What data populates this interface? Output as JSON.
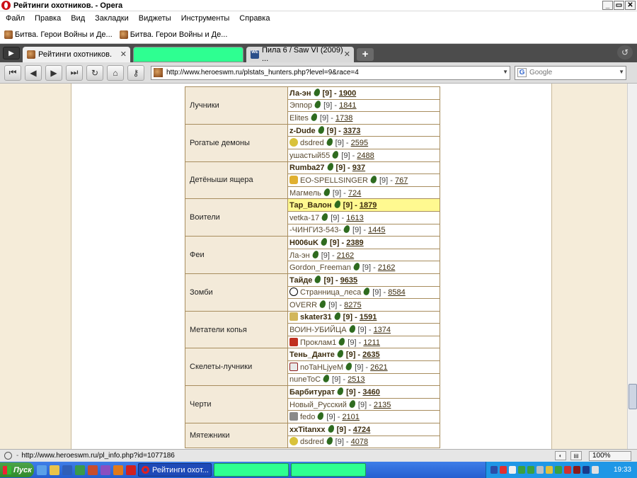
{
  "window": {
    "title": "Рейтинги охотников. - Opera",
    "controls": [
      "_",
      "▭",
      "✕"
    ]
  },
  "menu": [
    "Файл",
    "Правка",
    "Вид",
    "Закладки",
    "Виджеты",
    "Инструменты",
    "Справка"
  ],
  "bookmarks": [
    "Битва. Герои Войны и Де...",
    "Битва. Герои Войны и Де..."
  ],
  "tabs": [
    {
      "label": "Рейтинги охотников.",
      "state": "active",
      "close": "✕"
    },
    {
      "label": "",
      "state": "redacted",
      "color": "#2eff91"
    },
    {
      "label": "Пила 6 / Saw VI (2009) ...",
      "state": "inactive",
      "icon": "WE",
      "close": "✕"
    }
  ],
  "new_tab_label": "+",
  "nav": {
    "address": "http://www.heroeswm.ru/plstats_hunters.php?level=9&race=4",
    "search_placeholder": "Google",
    "search_icon_letter": "G"
  },
  "ratings": [
    {
      "class": "Лучники",
      "players": [
        {
          "nick": "Ла-эн",
          "level": "[9]",
          "score": "1900",
          "top": true
        },
        {
          "nick": "Эппор",
          "level": "[9]",
          "score": "1841"
        },
        {
          "nick": "Elites",
          "level": "[9]",
          "score": "1738"
        }
      ]
    },
    {
      "class": "Рогатые демоны",
      "players": [
        {
          "nick": "z-Dude",
          "level": "[9]",
          "score": "3373",
          "top": true
        },
        {
          "nick": "dsdred",
          "level": "[9]",
          "score": "2595",
          "badge": "lemon"
        },
        {
          "nick": "ушастый55",
          "level": "[9]",
          "score": "2488"
        }
      ]
    },
    {
      "class": "Детёныши ящера",
      "players": [
        {
          "nick": "Rumba27",
          "level": "[9]",
          "score": "937",
          "top": true
        },
        {
          "nick": "EO-SPELLSINGER",
          "level": "[9]",
          "score": "767",
          "badge": "crown"
        },
        {
          "nick": "Магмель",
          "level": "[9]",
          "score": "724"
        }
      ]
    },
    {
      "class": "Воители",
      "players": [
        {
          "nick": "Тар_Валон",
          "level": "[9]",
          "score": "1879",
          "top": true,
          "highlight": true
        },
        {
          "nick": "vetka-17",
          "level": "[9]",
          "score": "1613"
        },
        {
          "nick": "-ЧИНГИЗ-543-",
          "level": "[9]",
          "score": "1445"
        }
      ]
    },
    {
      "class": "Феи",
      "players": [
        {
          "nick": "H006uK",
          "level": "[9]",
          "score": "2389",
          "top": true
        },
        {
          "nick": "Ла-эн",
          "level": "[9]",
          "score": "2162"
        },
        {
          "nick": "Gordon_Freeman",
          "level": "[9]",
          "score": "2162"
        }
      ]
    },
    {
      "class": "Зомби",
      "players": [
        {
          "nick": "Тайде",
          "level": "[9]",
          "score": "9635",
          "top": true
        },
        {
          "nick": "Странница_леса",
          "level": "[9]",
          "score": "8584",
          "badge": "yin"
        },
        {
          "nick": "OVERR",
          "level": "[9]",
          "score": "8275"
        }
      ]
    },
    {
      "class": "Метатели копья",
      "players": [
        {
          "nick": "skater31",
          "level": "[9]",
          "score": "1591",
          "top": true,
          "badge": "scroll"
        },
        {
          "nick": "ВОИН-УБИЙЦА",
          "level": "[9]",
          "score": "1374"
        },
        {
          "nick": "Проклам1",
          "level": "[9]",
          "score": "1211",
          "badge": "red"
        }
      ]
    },
    {
      "class": "Скелеты-лучники",
      "players": [
        {
          "nick": "Тень_Данте",
          "level": "[9]",
          "score": "2635",
          "top": true
        },
        {
          "nick": "noTaHLjyeM",
          "level": "[9]",
          "score": "2621",
          "badge": "web"
        },
        {
          "nick": "nuneToC",
          "level": "[9]",
          "score": "2513"
        }
      ]
    },
    {
      "class": "Черти",
      "players": [
        {
          "nick": "Барбитурат",
          "level": "[9]",
          "score": "3460",
          "top": true
        },
        {
          "nick": "Новый_Русский",
          "level": "[9]",
          "score": "2135"
        },
        {
          "nick": "fedo",
          "level": "[9]",
          "score": "2101",
          "badge": "gray"
        }
      ]
    },
    {
      "class": "Мятежники",
      "players": [
        {
          "nick": "xxTitanxx",
          "level": "[9]",
          "score": "4724",
          "top": true
        },
        {
          "nick": "dsdred",
          "level": "[9]",
          "score": "4078",
          "badge": "lemon"
        }
      ]
    }
  ],
  "status": {
    "url": "http://www.heroeswm.ru/pl_info.php?id=1077186",
    "zoom": "100%"
  },
  "taskbar": {
    "start": "Пуск",
    "active_task": "Рейтинги охот...",
    "redacted_color": "#2eff91",
    "clock": "19:33"
  }
}
